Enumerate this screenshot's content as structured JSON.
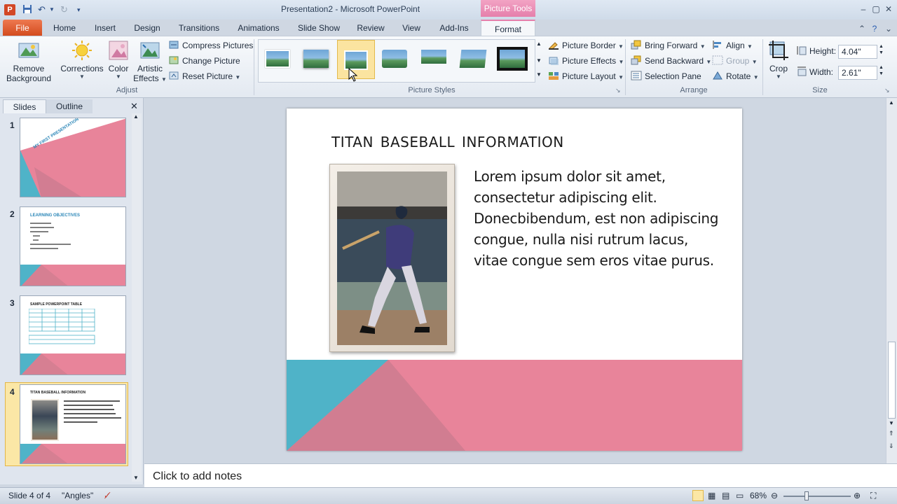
{
  "window": {
    "title": "Presentation2 - Microsoft PowerPoint",
    "app_icon": "P",
    "contextual_tab": "Picture Tools",
    "controls": [
      "minimize-icon",
      "restore-icon",
      "close-icon"
    ]
  },
  "quick_access": {
    "icons": [
      "save-icon",
      "undo-icon",
      "redo-icon",
      "customize-icon"
    ]
  },
  "tabs": [
    "File",
    "Home",
    "Insert",
    "Design",
    "Transitions",
    "Animations",
    "Slide Show",
    "Review",
    "View",
    "Add-Ins",
    "Format"
  ],
  "active_tab": "Format",
  "ribbon": {
    "adjust": {
      "label": "Adjust",
      "remove_background_1": "Remove",
      "remove_background_2": "Background",
      "corrections": "Corrections",
      "color": "Color",
      "artistic_1": "Artistic",
      "artistic_2": "Effects",
      "compress": "Compress Pictures",
      "change": "Change Picture",
      "reset": "Reset Picture"
    },
    "picture_styles": {
      "label": "Picture Styles",
      "border": "Picture Border",
      "effects": "Picture Effects",
      "layout": "Picture Layout"
    },
    "arrange": {
      "label": "Arrange",
      "bring_forward": "Bring Forward",
      "send_backward": "Send Backward",
      "selection_pane": "Selection Pane",
      "align": "Align",
      "group": "Group",
      "rotate": "Rotate"
    },
    "size": {
      "label": "Size",
      "crop": "Crop",
      "height_label": "Height:",
      "height_value": "4.04\"",
      "width_label": "Width:",
      "width_value": "2.61\""
    }
  },
  "panel": {
    "tab_slides": "Slides",
    "tab_outline": "Outline",
    "slide_numbers": [
      "1",
      "2",
      "3",
      "4"
    ],
    "thumb1_title": "MY FIRST PRESENTATION",
    "thumb2_title": "LEARNING OBJECTIVES",
    "thumb3_title": "SAMPLE POWERPOINT TABLE",
    "thumb4_title": "TITAN BASEBALL INFORMATION"
  },
  "slide": {
    "title": "TITAN BASEBALL INFORMATION",
    "body": "Lorem ipsum dolor sit amet, consectetur adipiscing elit. Donecbibendum, est non adipiscing congue, nulla nisi rutrum lacus, vitae congue sem eros vitae purus."
  },
  "notes_placeholder": "Click to add notes",
  "status": {
    "slide_info": "Slide 4 of 4",
    "theme": "\"Angles\"",
    "zoom": "68%"
  },
  "colors": {
    "accent_pink": "#e8849a",
    "accent_teal": "#4fb3c8",
    "ribbon_bg": "#e3e9f1",
    "selected_thumb": "#fbe7a6"
  }
}
